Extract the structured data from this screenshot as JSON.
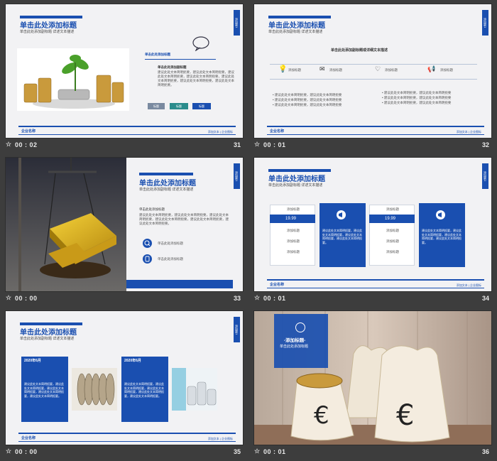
{
  "slides": [
    {
      "number": "31",
      "time": "00 : 02",
      "title": "单击此处添加标题",
      "subtitle": "单击此处添加副标题 详述文本描述",
      "tab": "添加第1",
      "caption": "单击此处添加标题",
      "body_heading": "单击此处添加副标题",
      "body": "建议此处文本简明扼要，建议此处文本简明扼要，建议此处文本简明扼要，建议此处文本简明扼要，建议此处文本简明扼要，建议此处文本简明扼要，建议此处文本简明扼要。",
      "buttons": [
        "标题",
        "标题",
        "标题"
      ],
      "footer_name": "企业名称",
      "footer_right": "添加文本 | 企业图标"
    },
    {
      "number": "32",
      "time": "00 : 01",
      "title": "单击此处添加标题",
      "subtitle": "单击此处添加副标题 详述文本描述",
      "tab": "添加第1",
      "heading": "单击此处添加副标题或详细文本描述",
      "icon_labels": [
        "添加标题",
        "添加标题",
        "添加标题",
        "添加标题"
      ],
      "bullets_left": [
        "建议此处文本简明扼要，建议此处文本简明扼要",
        "建议此处文本简明扼要，建议此处文本简明扼要",
        "建议此处文本简明扼要，建议此处文本简明扼要"
      ],
      "bullets_right": [
        "建议此处文本简明扼要，建议此处文本简明扼要",
        "建议此处文本简明扼要，建议此处文本简明扼要",
        "建议此处文本简明扼要，建议此处文本简明扼要"
      ],
      "footer_name": "企业名称",
      "footer_right": "添加文本 | 企业图标"
    },
    {
      "number": "33",
      "time": "00 : 00",
      "title": "单击此处添加标题",
      "subtitle": "单击此处添加副标题 详述文本描述",
      "tab": "添加第1",
      "body_heading": "单击此处添加标题",
      "body": "建议此处文本简明扼要，建议此处文本简明扼要，建议此处文本简明扼要，建议此处文本简明扼要，建议此处文本简明扼要，建议此处文本简明扼要。",
      "items": [
        "单击此处添加标题",
        "单击此处添加标题"
      ]
    },
    {
      "number": "34",
      "time": "00 : 01",
      "title": "单击此处添加标题",
      "subtitle": "单击此处添加副标题 详述文本描述",
      "tab": "添加第1",
      "table_rows": [
        "添加标题",
        "添加标题",
        "添加标题",
        "添加标题"
      ],
      "price": "19.99",
      "panel_text": "建议此处文本简明扼要，建议此处文本简明扼要，建议此处文本简明扼要，建议此处文本简明扼要。",
      "footer_name": "企业名称",
      "footer_right": "添加文本 | 企业图标"
    },
    {
      "number": "35",
      "time": "00 : 00",
      "title": "单击此处添加标题",
      "subtitle": "单击此处添加副标题 详述文本描述",
      "tab": "添加第1",
      "date": "2020年6月",
      "panel_text": "建议此处文本简明扼要，建议此处文本简明扼要，建议此处文本简明扼要，建议此处文本简明扼要，建议此处文本简明扼要。",
      "footer_name": "企业名称",
      "footer_right": "添加文本 | 企业图标"
    },
    {
      "number": "36",
      "time": "00 : 01",
      "box_title": "-添加标题-",
      "box_sub": "单击此处添加标题"
    }
  ],
  "colors": {
    "accent": "#1a4fb0",
    "teal": "#2a8c8c",
    "gray": "#7a8aa0"
  }
}
